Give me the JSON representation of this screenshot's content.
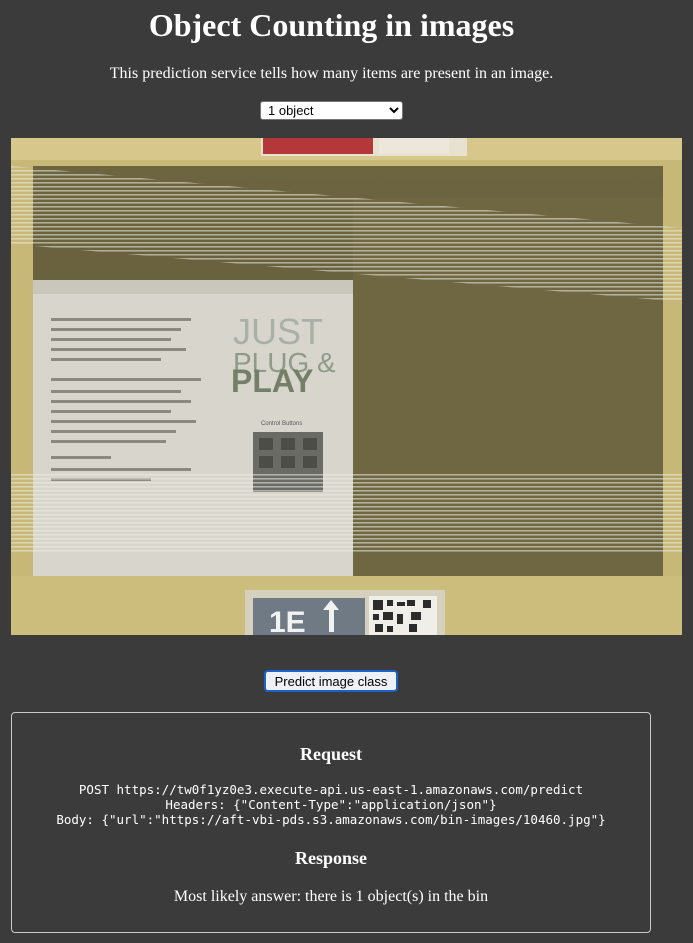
{
  "page": {
    "title": "Object Counting in images",
    "subtitle": "This prediction service tells how many items are present in an image."
  },
  "class_select": {
    "selected": "1 object"
  },
  "image": {
    "box_text_lines": [
      "JUST",
      "PLUG &",
      "PLAY"
    ],
    "box_panel_label": "Control Buttons",
    "bin_label": "1E"
  },
  "predict_button": {
    "label": "Predict image class"
  },
  "request": {
    "heading": "Request",
    "line1": "POST https://tw0f1yz0e3.execute-api.us-east-1.amazonaws.com/predict",
    "line2": "Headers: {\"Content-Type\":\"application/json\"}",
    "line3": "Body: {\"url\":\"https://aft-vbi-pds.s3.amazonaws.com/bin-images/10460.jpg\"}"
  },
  "response": {
    "heading": "Response",
    "text": "Most likely answer: there is 1 object(s) in the bin"
  },
  "colors": {
    "background": "#3b3b3b",
    "text": "#ffffff",
    "button_border": "#1b63c6",
    "panel_border": "#c9c9c9"
  }
}
